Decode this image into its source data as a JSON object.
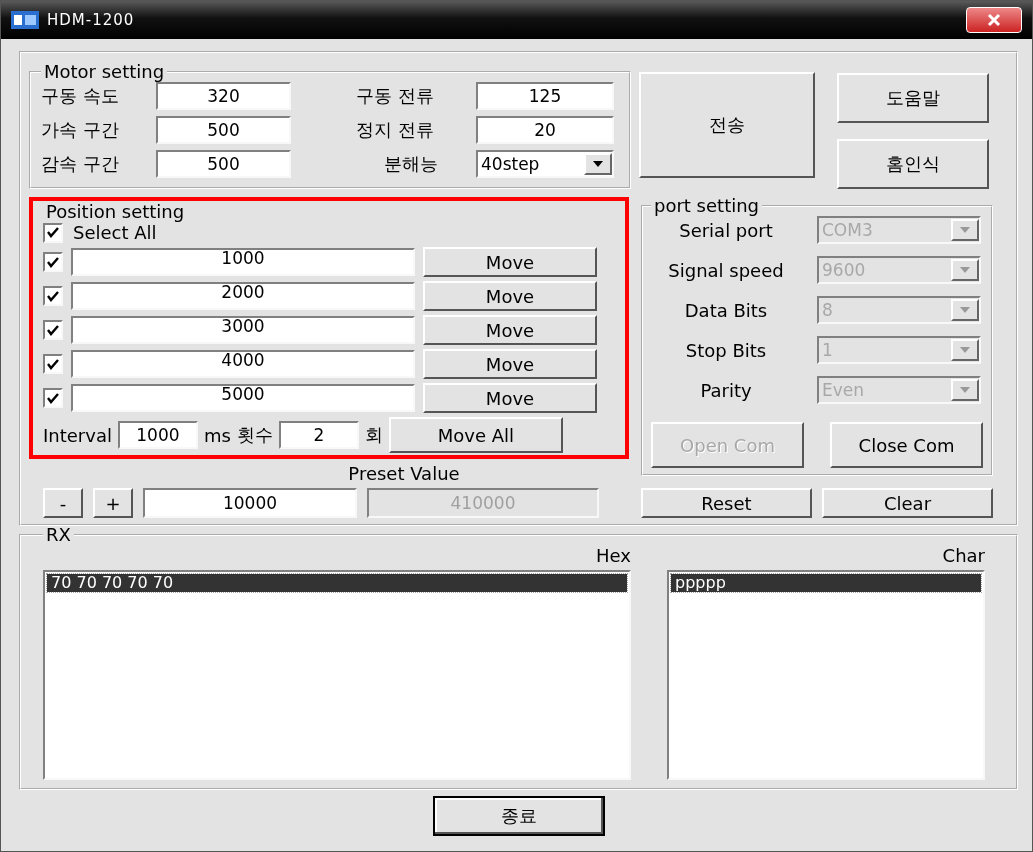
{
  "window": {
    "title": "HDM-1200"
  },
  "motor_setting": {
    "title": "Motor setting",
    "fields": [
      {
        "label": "구동 속도",
        "value": "320"
      },
      {
        "label": "구동 전류",
        "value": "125"
      },
      {
        "label": "가속 구간",
        "value": "500"
      },
      {
        "label": "정지 전류",
        "value": "20"
      },
      {
        "label": "감속 구간",
        "value": "500"
      }
    ],
    "resolution": {
      "label": "분해능",
      "value": "40step"
    }
  },
  "send_button": "전송",
  "help_button": "도움말",
  "home_button": "홈인식",
  "position_setting": {
    "title": "Position setting",
    "select_all": {
      "label": "Select All",
      "checked": true
    },
    "positions": [
      {
        "checked": true,
        "value": "1000",
        "button": "Move"
      },
      {
        "checked": true,
        "value": "2000",
        "button": "Move"
      },
      {
        "checked": true,
        "value": "3000",
        "button": "Move"
      },
      {
        "checked": true,
        "value": "4000",
        "button": "Move"
      },
      {
        "checked": true,
        "value": "5000",
        "button": "Move"
      }
    ],
    "interval": {
      "label": "Interval",
      "value": "1000",
      "unit": "ms"
    },
    "count": {
      "label": "횟수",
      "value": "2",
      "unit": "회"
    },
    "move_all_button": "Move All"
  },
  "preset": {
    "title": "Preset Value",
    "minus": "-",
    "plus": "+",
    "value": "10000",
    "readout": "410000"
  },
  "port_setting": {
    "title": "port setting",
    "fields": [
      {
        "label": "Serial port",
        "value": "COM3",
        "disabled": true
      },
      {
        "label": "Signal speed",
        "value": "9600",
        "disabled": true
      },
      {
        "label": "Data Bits",
        "value": "8",
        "disabled": true
      },
      {
        "label": "Stop Bits",
        "value": "1",
        "disabled": true
      },
      {
        "label": "Parity",
        "value": "Even",
        "disabled": true
      }
    ],
    "open_button": {
      "label": "Open Com",
      "disabled": true
    },
    "close_button": {
      "label": "Close Com",
      "disabled": false
    }
  },
  "reset_button": "Reset",
  "clear_button": "Clear",
  "rx": {
    "title": "RX",
    "hex": {
      "label": "Hex",
      "items": [
        {
          "text": "70 70 70 70 70",
          "selected": true
        }
      ]
    },
    "char": {
      "label": "Char",
      "items": [
        {
          "text": "ppppp",
          "selected": true
        }
      ]
    }
  },
  "exit_button": "종료"
}
